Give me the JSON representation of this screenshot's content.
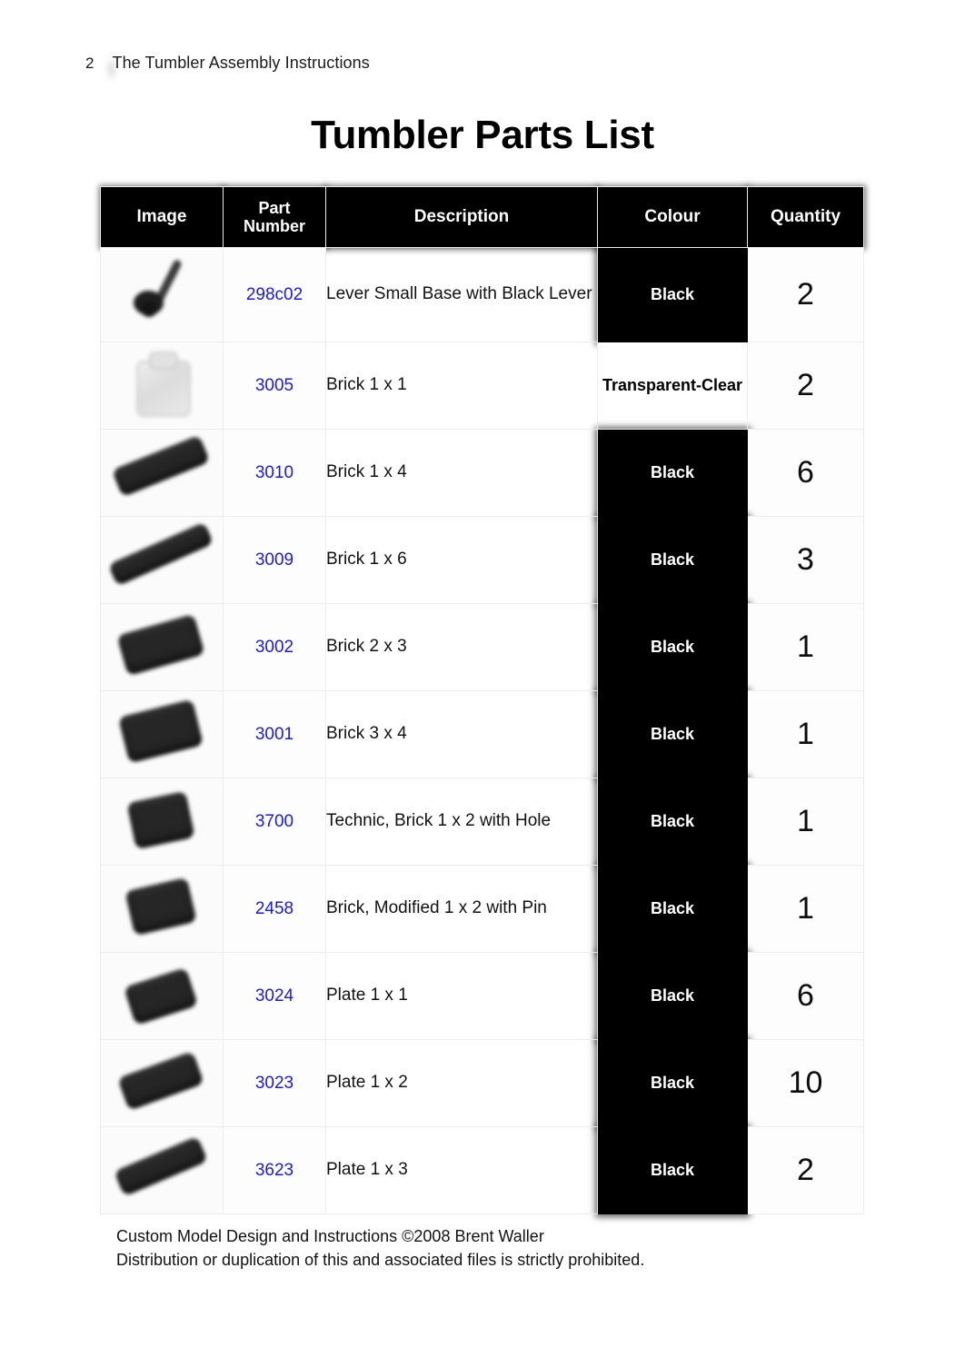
{
  "document": {
    "page_number": "2",
    "running_header": "The Tumbler Assembly Instructions",
    "title": "Tumbler Parts List"
  },
  "table": {
    "columns": [
      {
        "key": "image",
        "label": "Image"
      },
      {
        "key": "part",
        "label": "Part Number",
        "label_line1": "Part",
        "label_line2": "Number"
      },
      {
        "key": "desc",
        "label": "Description"
      },
      {
        "key": "colour",
        "label": "Colour"
      },
      {
        "key": "quantity",
        "label": "Quantity"
      }
    ],
    "rows": [
      {
        "part_number": "298c02",
        "description": "Lever Small Base with Black Lever",
        "colour": "Black",
        "quantity": "2",
        "image": "lego-lever-small-base"
      },
      {
        "part_number": "3005",
        "description": "Brick 1 x 1",
        "colour": "Transparent-Clear",
        "quantity": "2",
        "image": "lego-brick-1x1-clear"
      },
      {
        "part_number": "3010",
        "description": "Brick 1 x 4",
        "colour": "Black",
        "quantity": "6",
        "image": "lego-brick-1x4-black"
      },
      {
        "part_number": "3009",
        "description": "Brick 1 x 6",
        "colour": "Black",
        "quantity": "3",
        "image": "lego-brick-1x6-black"
      },
      {
        "part_number": "3002",
        "description": "Brick 2 x 3",
        "colour": "Black",
        "quantity": "1",
        "image": "lego-brick-2x3-black"
      },
      {
        "part_number": "3001",
        "description": "Brick 3 x 4",
        "colour": "Black",
        "quantity": "1",
        "image": "lego-brick-3x4-black"
      },
      {
        "part_number": "3700",
        "description": "Technic, Brick 1 x 2 with Hole",
        "colour": "Black",
        "quantity": "1",
        "image": "lego-technic-brick-1x2-hole-black"
      },
      {
        "part_number": "2458",
        "description": "Brick, Modified 1 x 2 with Pin",
        "colour": "Black",
        "quantity": "1",
        "image": "lego-brick-modified-1x2-pin-black"
      },
      {
        "part_number": "3024",
        "description": "Plate 1 x 1",
        "colour": "Black",
        "quantity": "6",
        "image": "lego-plate-1x1-black"
      },
      {
        "part_number": "3023",
        "description": "Plate 1 x 2",
        "colour": "Black",
        "quantity": "10",
        "image": "lego-plate-1x2-black"
      },
      {
        "part_number": "3623",
        "description": "Plate 1 x 3",
        "colour": "Black",
        "quantity": "2",
        "image": "lego-plate-1x3-black"
      }
    ]
  },
  "footer": {
    "line1": "Custom Model Design and Instructions ©2008 Brent Waller",
    "line2": "Distribution or duplication of this and associated files is strictly prohibited."
  },
  "colors": {
    "part_number_link": "#1a1ae6",
    "header_background": "#000000",
    "header_text": "#ffffff",
    "page_background": "#ffffff"
  }
}
